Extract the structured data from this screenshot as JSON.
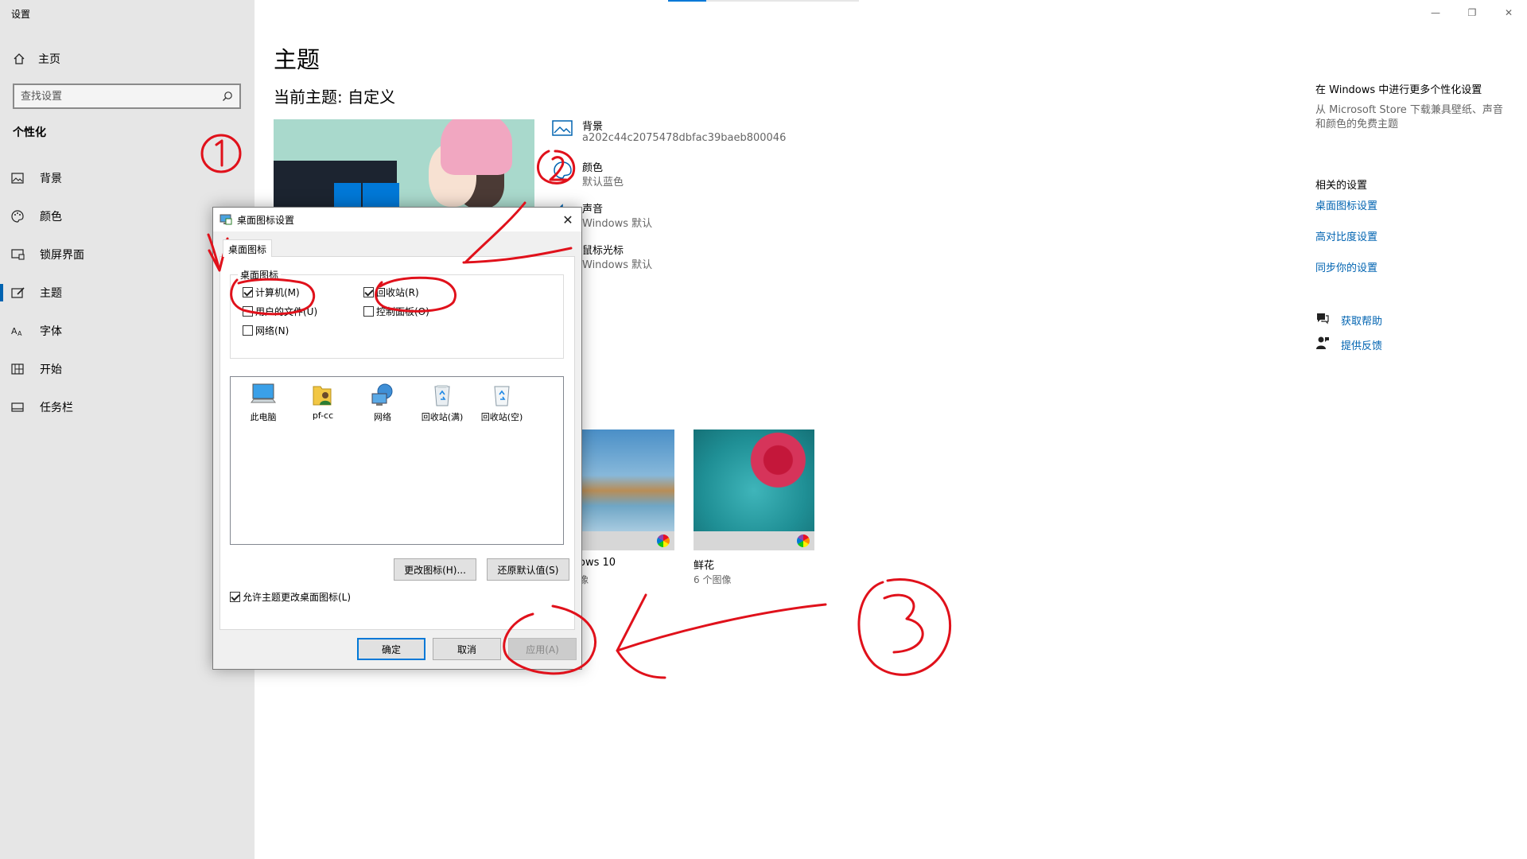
{
  "app": {
    "title": "设置"
  },
  "sidebar": {
    "home_label": "主页",
    "search_placeholder": "查找设置",
    "section_title": "个性化",
    "items": [
      {
        "label": "背景",
        "icon": "picture-icon"
      },
      {
        "label": "颜色",
        "icon": "palette-icon"
      },
      {
        "label": "锁屏界面",
        "icon": "lock-screen-icon"
      },
      {
        "label": "主题",
        "icon": "brush-icon",
        "active": true
      },
      {
        "label": "字体",
        "icon": "font-icon"
      },
      {
        "label": "开始",
        "icon": "start-icon"
      },
      {
        "label": "任务栏",
        "icon": "taskbar-icon"
      }
    ]
  },
  "main": {
    "title": "主题",
    "current_theme": "当前主题: 自定义",
    "options": [
      {
        "title": "背景",
        "subtitle": "a202c44c2075478dbfac39baeb800046"
      },
      {
        "title": "颜色",
        "subtitle": "默认蓝色"
      },
      {
        "title": "声音",
        "subtitle": "Windows 默认"
      },
      {
        "title": "鼠标光标",
        "subtitle": "Windows 默认"
      }
    ],
    "themes": [
      {
        "name": "ows 10",
        "sub": "像"
      },
      {
        "name": "鲜花",
        "sub": "6 个图像"
      }
    ]
  },
  "right_pane": {
    "heading": "在 Windows 中进行更多个性化设置",
    "description": "从 Microsoft Store 下载兼具壁纸、声音和颜色的免费主题",
    "related_title": "相关的设置",
    "links": [
      "桌面图标设置",
      "高对比度设置",
      "同步你的设置"
    ],
    "help": "获取帮助",
    "feedback": "提供反馈"
  },
  "dialog": {
    "title": "桌面图标设置",
    "tab": "桌面图标",
    "group_label": "桌面图标",
    "checkboxes": [
      {
        "label": "计算机(M)",
        "checked": true
      },
      {
        "label": "回收站(R)",
        "checked": true
      },
      {
        "label": "用户的文件(U)",
        "checked": false
      },
      {
        "label": "控制面板(O)",
        "checked": false
      },
      {
        "label": "网络(N)",
        "checked": false
      }
    ],
    "icons": [
      {
        "label": "此电脑",
        "icon": "this-pc-icon"
      },
      {
        "label": "pf-cc",
        "icon": "user-folder-icon"
      },
      {
        "label": "网络",
        "icon": "network-icon"
      },
      {
        "label": "回收站(满)",
        "icon": "recycle-bin-full-icon"
      },
      {
        "label": "回收站(空)",
        "icon": "recycle-bin-empty-icon"
      }
    ],
    "change_icon_button": "更改图标(H)...",
    "restore_default_button": "还原默认值(S)",
    "allow_themes_label": "允许主题更改桌面图标(L)",
    "allow_themes_checked": true,
    "ok_button": "确定",
    "cancel_button": "取消",
    "apply_button": "应用(A)"
  },
  "colors": {
    "accent": "#0078d7",
    "link": "#0063b1",
    "annotation": "#e0111b",
    "sidebar_bg": "#e6e6e6"
  }
}
